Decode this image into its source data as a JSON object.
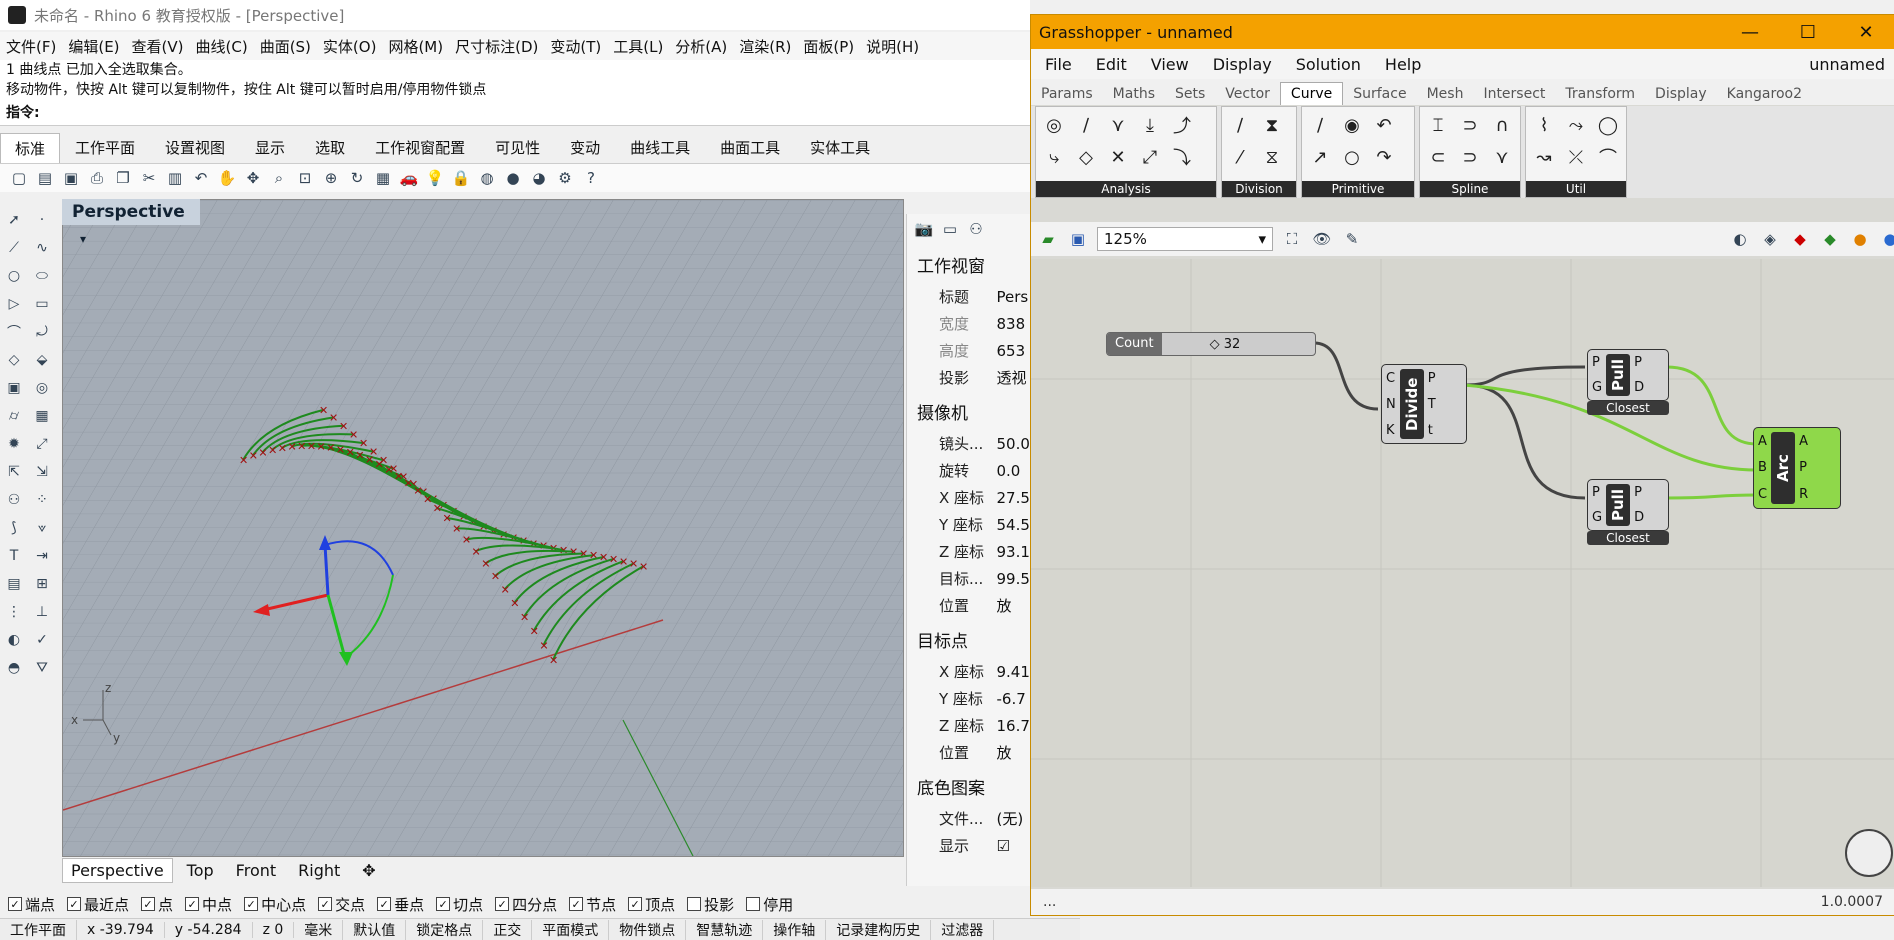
{
  "rhino": {
    "title": "未命名 - Rhino 6 教育授权版 - [Perspective]",
    "menu": [
      "文件(F)",
      "编辑(E)",
      "查看(V)",
      "曲线(C)",
      "曲面(S)",
      "实体(O)",
      "网格(M)",
      "尺寸标注(D)",
      "变动(T)",
      "工具(L)",
      "分析(A)",
      "渲染(R)",
      "面板(P)",
      "说明(H)"
    ],
    "cmd_history": [
      "1 曲线点 已加入全选取集合。",
      "移动物件，快按 Alt 键可以复制物件，按住 Alt 键可以暂时启用/停用物件锁点"
    ],
    "cmd_prompt": "指令:",
    "tabs": [
      "标准",
      "工作平面",
      "设置视图",
      "显示",
      "选取",
      "工作视窗配置",
      "可见性",
      "变动",
      "曲线工具",
      "曲面工具",
      "实体工具"
    ],
    "viewport_title": "Perspective",
    "viewport_tabs": [
      "Perspective",
      "Top",
      "Front",
      "Right"
    ],
    "props": {
      "viewport_head": "工作视窗",
      "viewport_rows": [
        {
          "k": "标题",
          "v": "Pers"
        },
        {
          "k": "宽度",
          "v": "838"
        },
        {
          "k": "高度",
          "v": "653"
        },
        {
          "k": "投影",
          "v": "透视"
        }
      ],
      "camera_head": "摄像机",
      "camera_rows": [
        {
          "k": "镜头...",
          "v": "50.0"
        },
        {
          "k": "旋转",
          "v": "0.0"
        },
        {
          "k": "X 座标",
          "v": "27.5"
        },
        {
          "k": "Y 座标",
          "v": "54.5"
        },
        {
          "k": "Z 座标",
          "v": "93.1"
        },
        {
          "k": "目标...",
          "v": "99.5"
        },
        {
          "k": "位置",
          "v": "放"
        }
      ],
      "target_head": "目标点",
      "target_rows": [
        {
          "k": "X 座标",
          "v": "9.41"
        },
        {
          "k": "Y 座标",
          "v": "-6.7"
        },
        {
          "k": "Z 座标",
          "v": "16.7"
        },
        {
          "k": "位置",
          "v": "放"
        }
      ],
      "wallpaper_head": "底色图案",
      "wallpaper_rows": [
        {
          "k": "文件...",
          "v": "(无)"
        },
        {
          "k": "显示",
          "v": "☑"
        }
      ]
    },
    "osnaps": [
      {
        "label": "端点",
        "checked": true
      },
      {
        "label": "最近点",
        "checked": true
      },
      {
        "label": "点",
        "checked": true
      },
      {
        "label": "中点",
        "checked": true
      },
      {
        "label": "中心点",
        "checked": true
      },
      {
        "label": "交点",
        "checked": true
      },
      {
        "label": "垂点",
        "checked": true
      },
      {
        "label": "切点",
        "checked": true
      },
      {
        "label": "四分点",
        "checked": true
      },
      {
        "label": "节点",
        "checked": true
      },
      {
        "label": "顶点",
        "checked": true
      },
      {
        "label": "投影",
        "checked": false
      },
      {
        "label": "停用",
        "checked": false
      }
    ],
    "status": [
      "工作平面",
      "x -39.794",
      "y -54.284",
      "z 0",
      "毫米",
      "默认值",
      "锁定格点",
      "正交",
      "平面模式",
      "物件锁点",
      "智慧轨迹",
      "操作轴",
      "记录建构历史",
      "过滤器"
    ]
  },
  "gh": {
    "title": "Grasshopper - unnamed",
    "menu": [
      "File",
      "Edit",
      "View",
      "Display",
      "Solution",
      "Help"
    ],
    "doc_name": "unnamed",
    "tabs": [
      "Params",
      "Maths",
      "Sets",
      "Vector",
      "Curve",
      "Surface",
      "Mesh",
      "Intersect",
      "Transform",
      "Display",
      "Kangaroo2"
    ],
    "active_tab": "Curve",
    "groups": [
      "Analysis",
      "Division",
      "Primitive",
      "Spline",
      "Util"
    ],
    "zoom": "125%",
    "slider": {
      "label": "Count",
      "value": "◇ 32"
    },
    "divide": {
      "name": "Divide",
      "inputs": [
        "C",
        "N",
        "K"
      ],
      "outputs": [
        "P",
        "T",
        "t"
      ]
    },
    "pull1": {
      "name": "Pull",
      "inputs": [
        "P",
        "G"
      ],
      "outputs": [
        "P",
        "D"
      ],
      "caption": "Closest"
    },
    "pull2": {
      "name": "Pull",
      "inputs": [
        "P",
        "G"
      ],
      "outputs": [
        "P",
        "D"
      ],
      "caption": "Closest"
    },
    "arc": {
      "name": "Arc",
      "inputs": [
        "A",
        "B",
        "C"
      ],
      "outputs": [
        "A",
        "P",
        "R"
      ]
    },
    "status_left": "...",
    "status_right": "1.0.0007"
  },
  "colors": {
    "gh_title": "#f4a100",
    "wire": "#444444",
    "green_wire": "#7ccf3c",
    "curve": "#1e8a1e",
    "point": "#a01010"
  }
}
